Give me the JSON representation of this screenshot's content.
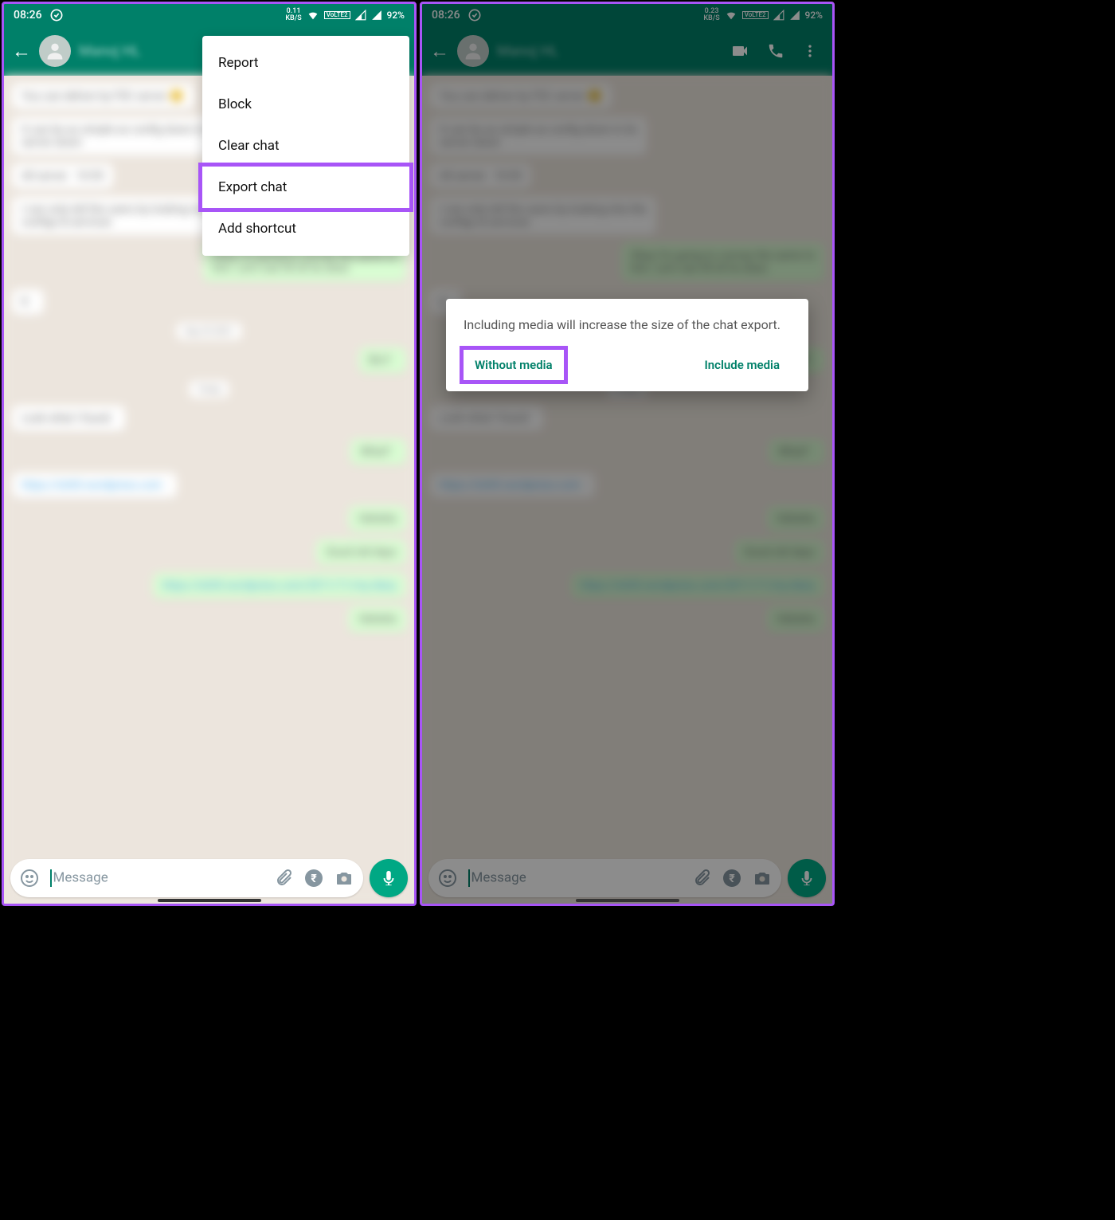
{
  "status": {
    "time": "08:26",
    "kbs_left": "0.11",
    "kbs_right": "0.23",
    "kbs_label": "KB/S",
    "lte": "VoLTE2",
    "battery": "92%"
  },
  "screen_left": {
    "header": {
      "contact_name": "Manoj HL"
    },
    "menu": {
      "report": "Report",
      "block": "Block",
      "clear": "Clear chat",
      "export": "Export chat",
      "shortcut": "Add shortcut"
    },
    "input": {
      "placeholder": "Message"
    }
  },
  "screen_right": {
    "header": {
      "contact_name": "Manoj HL"
    },
    "dialog": {
      "text": "Including media will increase the size of the chat export.",
      "without": "Without media",
      "include": "Include media"
    },
    "input": {
      "placeholder": "Message"
    }
  }
}
